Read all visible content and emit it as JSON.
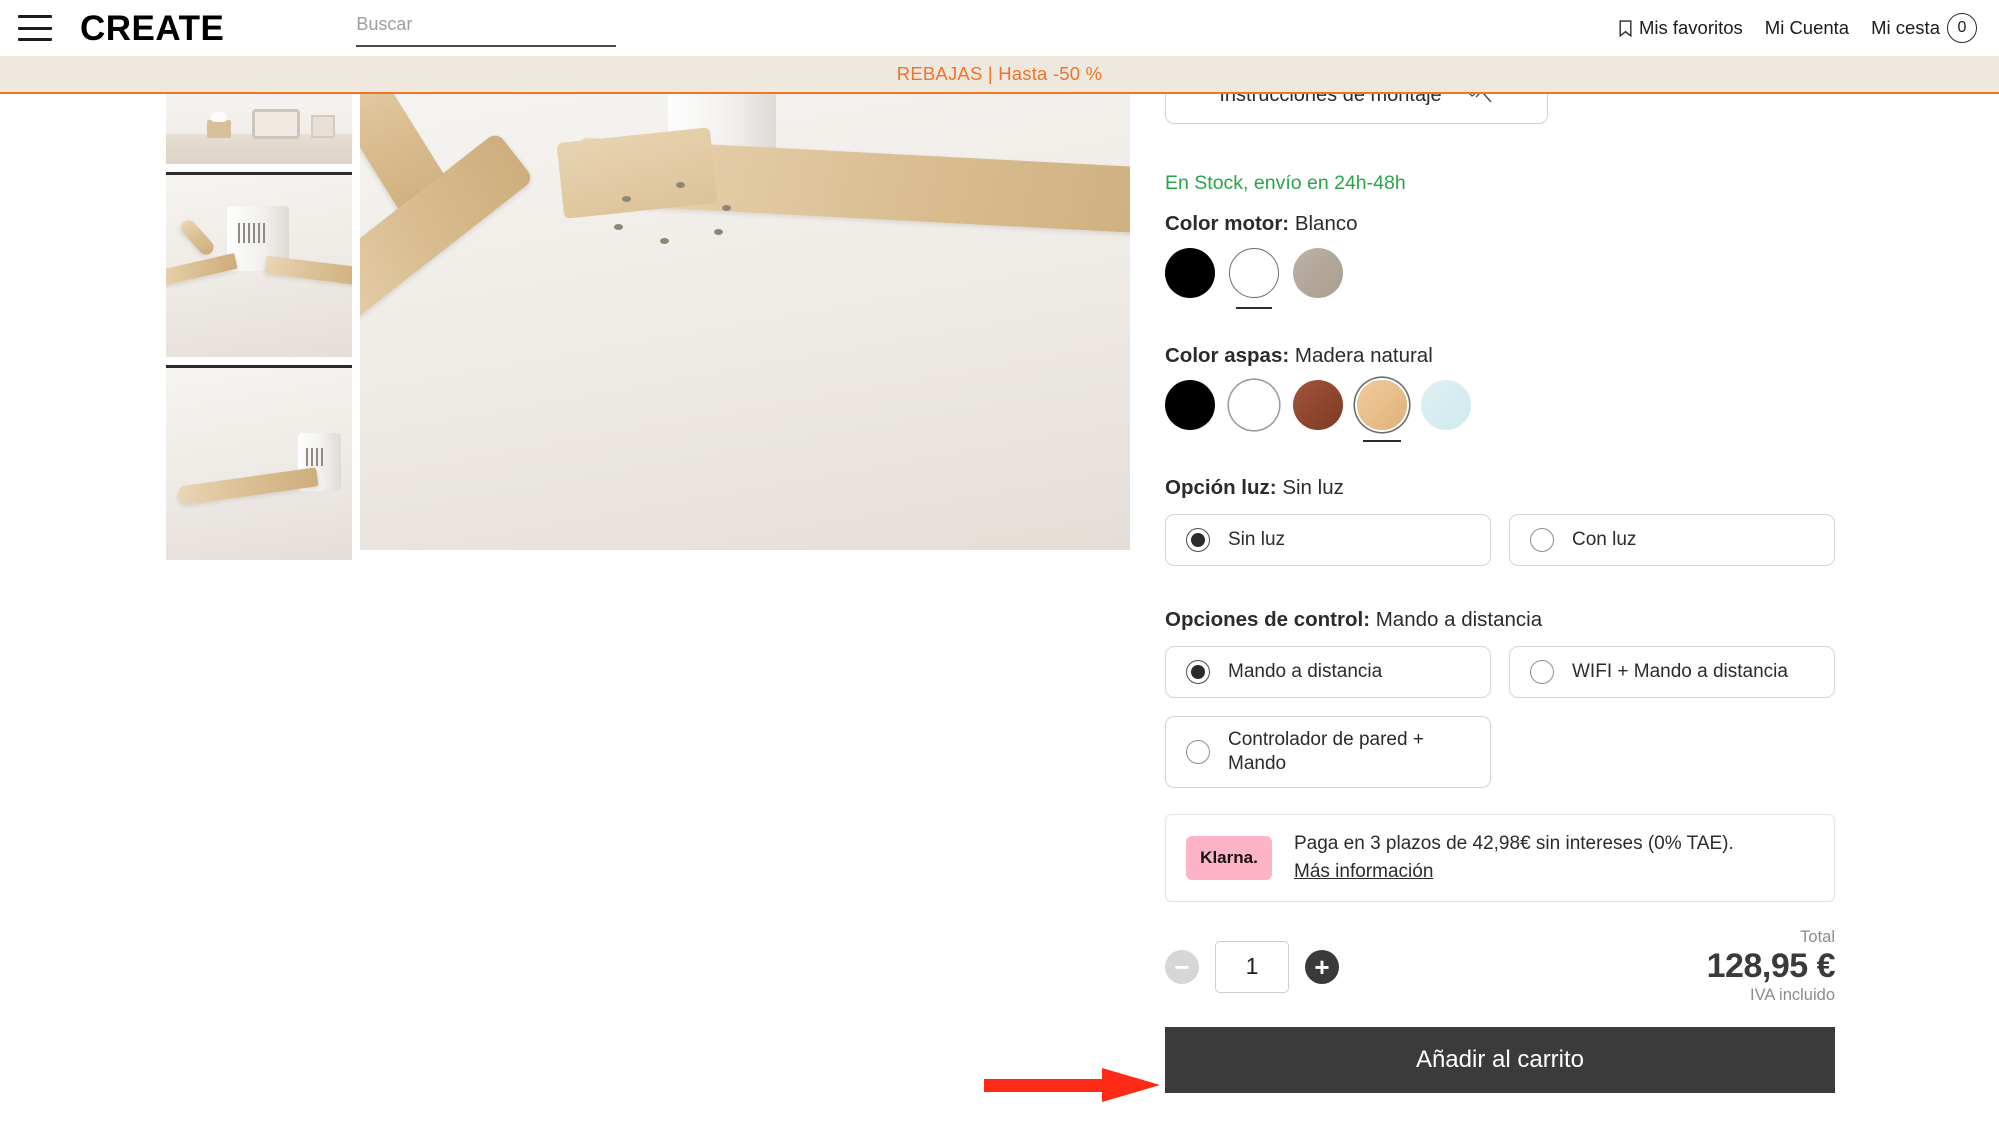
{
  "header": {
    "menu_icon": "hamburger-menu-icon",
    "logo": "CREATE",
    "search": {
      "placeholder": "Buscar",
      "value": ""
    },
    "favorites": "Mis favoritos",
    "account": "Mi Cuenta",
    "cart": "Mi cesta",
    "cart_count": "0"
  },
  "promo": {
    "text": "REBAJAS | Hasta -50 %",
    "color": "#ee742a",
    "background": "#efe8df"
  },
  "gallery": {
    "thumbnails": [
      {
        "name": "thumb-room-scene",
        "selected": false
      },
      {
        "name": "thumb-fan-closeup",
        "selected": true
      },
      {
        "name": "thumb-fan-blade",
        "selected": false
      }
    ],
    "hero": {
      "name": "hero-fan-blades-closeup"
    }
  },
  "product": {
    "instructions_button": "Instrucciones de montaje",
    "instructions_icon": "wrench-tool-icon",
    "stock": "En Stock, envío en 24h-48h",
    "stock_color": "#2aa34a",
    "motor_color": {
      "label": "Color motor:",
      "value": "Blanco",
      "swatches": [
        {
          "name": "swatch-motor-negro",
          "hex": "#000000",
          "selected": false
        },
        {
          "name": "swatch-motor-blanco",
          "hex": "#ffffff",
          "selected": true
        },
        {
          "name": "swatch-motor-taupe",
          "hex": "#b0a597",
          "selected": false
        }
      ]
    },
    "blade_color": {
      "label": "Color aspas:",
      "value": "Madera natural",
      "swatches": [
        {
          "name": "swatch-aspas-negro",
          "hex": "#000000",
          "selected": false
        },
        {
          "name": "swatch-aspas-blanco",
          "hex": "#ffffff",
          "selected": false
        },
        {
          "name": "swatch-aspas-madera-oscura",
          "hex": "#8c4329",
          "selected": false
        },
        {
          "name": "swatch-aspas-madera-natural",
          "hex": "#e6be88",
          "selected": true
        },
        {
          "name": "swatch-aspas-azul",
          "hex": "#d6ecf2",
          "selected": false
        }
      ]
    },
    "light_option": {
      "label": "Opción luz:",
      "value": "Sin luz",
      "options": [
        {
          "label": "Sin luz",
          "selected": true
        },
        {
          "label": "Con luz",
          "selected": false
        }
      ]
    },
    "control_option": {
      "label": "Opciones de control:",
      "value": "Mando a distancia",
      "options": [
        {
          "label": "Mando a distancia",
          "selected": true
        },
        {
          "label": "WIFI + Mando a distancia",
          "selected": false
        },
        {
          "label": "Controlador de pared + Mando",
          "selected": false
        }
      ]
    },
    "klarna": {
      "badge": "Klarna.",
      "badge_color": "#ffb3c7",
      "text": "Paga en 3 plazos de 42,98€ sin intereses (0% TAE).",
      "link": "Más información"
    },
    "quantity": {
      "value": "1",
      "minus": "−",
      "plus": "+"
    },
    "total": {
      "label": "Total",
      "amount": "128,95 €",
      "tax_note": "IVA incluido"
    },
    "add_to_cart": "Añadir al carrito"
  },
  "annotation": {
    "arrow": "red-arrow-pointing-to-add-to-cart",
    "color": "#ff2a15"
  }
}
